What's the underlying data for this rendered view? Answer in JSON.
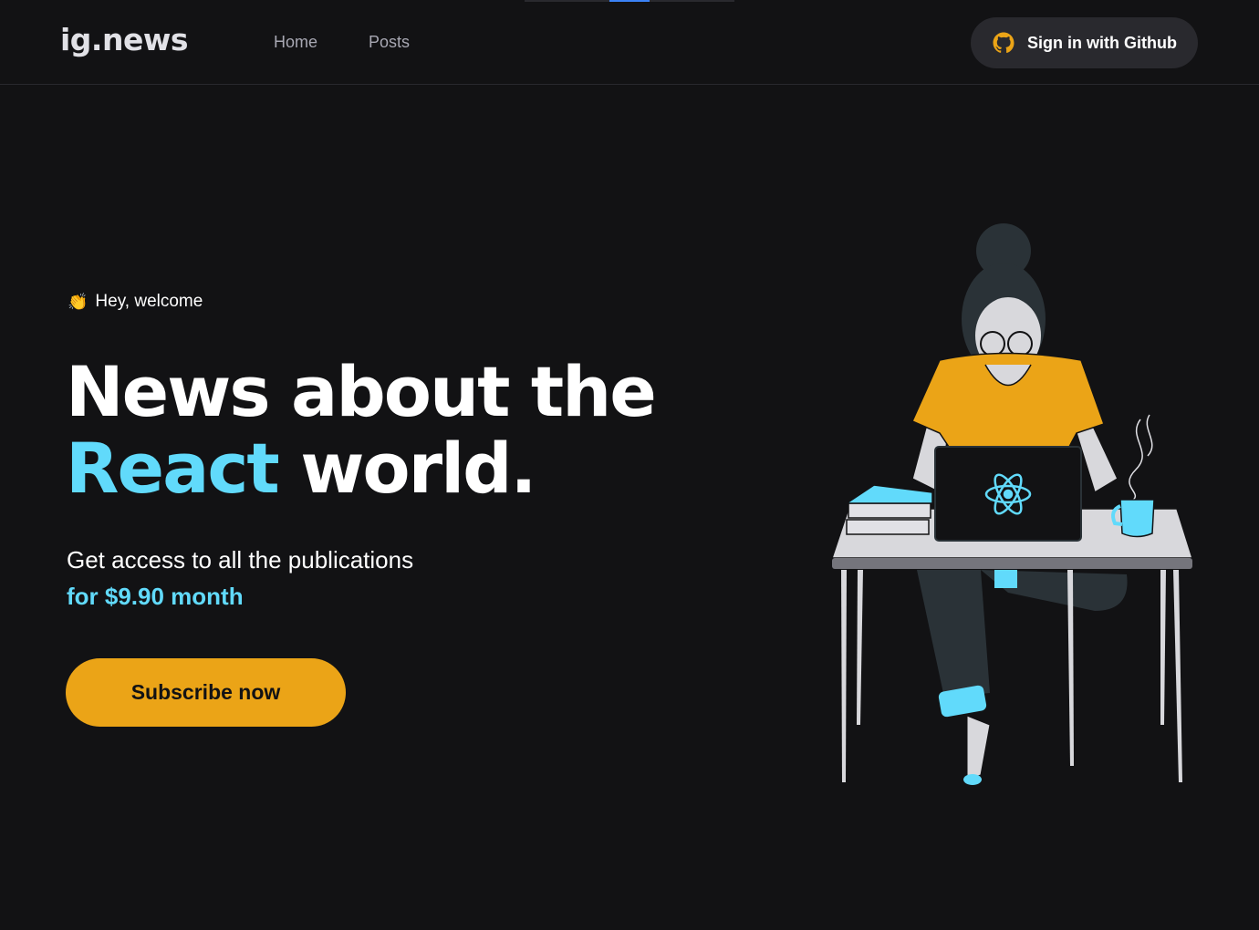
{
  "header": {
    "logo": "ig.news",
    "nav": [
      {
        "label": "Home"
      },
      {
        "label": "Posts"
      }
    ],
    "signin_label": "Sign in with Github",
    "signin_icon": "github-icon"
  },
  "hero": {
    "welcome_icon": "clapping-hands-emoji",
    "welcome_text": "Hey, welcome",
    "headline_part1": "News about the",
    "headline_accent": "React",
    "headline_part2": " world.",
    "subtitle": "Get access to all the publications",
    "price_text": "for $9.90 month",
    "cta_label": "Subscribe now"
  },
  "colors": {
    "background": "#121214",
    "accent_cyan": "#61dafb",
    "accent_yellow": "#eba417",
    "surface": "#29292e"
  }
}
